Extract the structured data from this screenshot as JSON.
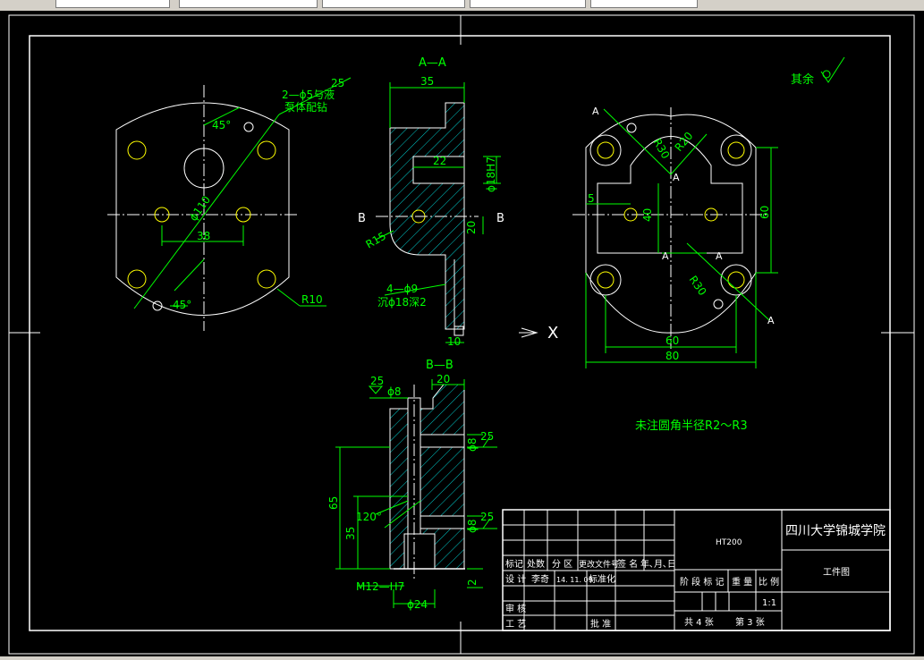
{
  "colors": {
    "background": "#000000",
    "lines": "#ffffff",
    "dimensions": "#00ff00",
    "centerlines": "#ffffff",
    "holes": "#ffff00",
    "hatch": "#00ffff"
  },
  "views": {
    "section_aa_title": "A—A",
    "section_bb_title": "B—B",
    "view_marker_x": "X",
    "cut_label_a": "A",
    "cut_label_b": "B"
  },
  "notes": {
    "surface_finish": "其余",
    "fillet_note": "未注圆角半径R2～R3"
  },
  "front_view": {
    "leader_holes": "2—ϕ5与液",
    "leader_holes_2": "泵体配钻",
    "roughness_top": "25",
    "angle_top": "45°",
    "angle_bottom": "45°",
    "diameter_pcd": "ϕ110",
    "dim_38": "38",
    "radius_r10": "R10"
  },
  "section_aa": {
    "dim_35": "35",
    "dim_22": "22",
    "dim_18h7": "ϕ18H7",
    "dim_20": "20",
    "dim_r15": "R15",
    "leader_holes": "4—ϕ9",
    "leader_holes_2": "沉ϕ18深2",
    "dim_10": "10"
  },
  "right_view": {
    "dim_r30_top": "R30",
    "dim_r20": "R20",
    "dim_5": "5",
    "dim_40": "40",
    "dim_60_vertical": "60",
    "dim_r30_bottom": "R30",
    "dim_60": "60",
    "dim_80": "80"
  },
  "section_bb": {
    "roughness_1": "25",
    "dim_phi8_top": "ϕ8",
    "dim_20": "20",
    "roughness_2": "25",
    "dim_phi8_mid": "ϕ8",
    "dim_65": "65",
    "angle_120": "120°",
    "dim_35": "35",
    "roughness_3": "25",
    "dim_phi8_low": "ϕ8",
    "thread": "M12—H7",
    "dim_2": "2",
    "dim_phi24": "ϕ24"
  },
  "title_block": {
    "material": "HT200",
    "school": "四川大学锦城学院",
    "drawing_name": "工件图",
    "hdr_mark": "标记",
    "hdr_count": "处数",
    "hdr_zone": "分 区",
    "hdr_change": "更改文件号",
    "hdr_sign": "签 名",
    "hdr_date": "年､月､日",
    "design": "设 计",
    "designer": "李奇",
    "design_date": "14. 11. 09",
    "standard": "标准化",
    "review": "审 核",
    "process": "工 艺",
    "approve": "批 准",
    "stage_mark": "阶 段 标 记",
    "weight": "重 量",
    "scale_label": "比 例",
    "scale": "1:1",
    "total_sheets": "共 4 张",
    "sheet_no": "第 3 张"
  }
}
